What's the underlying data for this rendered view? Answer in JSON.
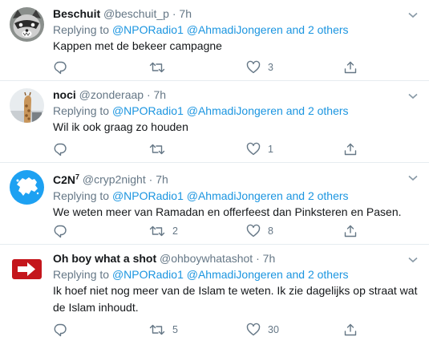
{
  "tweets": [
    {
      "name": "Beschuit",
      "handle": "@beschuit_p",
      "dot": "·",
      "time": "7h",
      "reply_prefix": "Replying to",
      "reply_user1": "@NPORadio1",
      "reply_user2": "@AhmadiJongeren",
      "reply_suffix": "and 2 others",
      "text": "Kappen met de bekeer campagne",
      "counts": {
        "replies": "",
        "retweets": "",
        "likes": "3"
      },
      "avatar_icon": "raccoon-avatar"
    },
    {
      "name": "noci",
      "handle": "@zonderaap",
      "dot": "·",
      "time": "7h",
      "reply_prefix": "Replying to",
      "reply_user1": "@NPORadio1",
      "reply_user2": "@AhmadiJongeren",
      "reply_suffix": "and 2 others",
      "text": "Wil ik ook graag zo houden",
      "counts": {
        "replies": "",
        "retweets": "",
        "likes": "1"
      },
      "avatar_icon": "giraffe-avatar"
    },
    {
      "name": "C2N",
      "name_sup": "7",
      "handle": "@cryp2night",
      "dot": "·",
      "time": "7h",
      "reply_prefix": "Replying to",
      "reply_user1": "@NPORadio1",
      "reply_user2": "@AhmadiJongeren",
      "reply_suffix": "and 2 others",
      "text": "We weten meer van Ramadan en offerfeest dan Pinksteren en Pasen.",
      "counts": {
        "replies": "",
        "retweets": "2",
        "likes": "8"
      },
      "avatar_icon": "europe-map-avatar"
    },
    {
      "name": "Oh boy what a shot",
      "handle": "@ohboywhatashot",
      "dot": "·",
      "time": "7h",
      "reply_prefix": "Replying to",
      "reply_user1": "@NPORadio1",
      "reply_user2": "@AhmadiJongeren",
      "reply_suffix": "and 2 others",
      "text": "Ik hoef niet nog meer van de Islam te weten. Ik zie dagelijks op straat wat de Islam inhoudt.",
      "counts": {
        "replies": "",
        "retweets": "5",
        "likes": "30"
      },
      "avatar_icon": "red-arrow-avatar"
    }
  ],
  "colors": {
    "link": "#1b95e0",
    "muted": "#657786",
    "text": "#14171a",
    "divider": "#e6ecf0"
  }
}
